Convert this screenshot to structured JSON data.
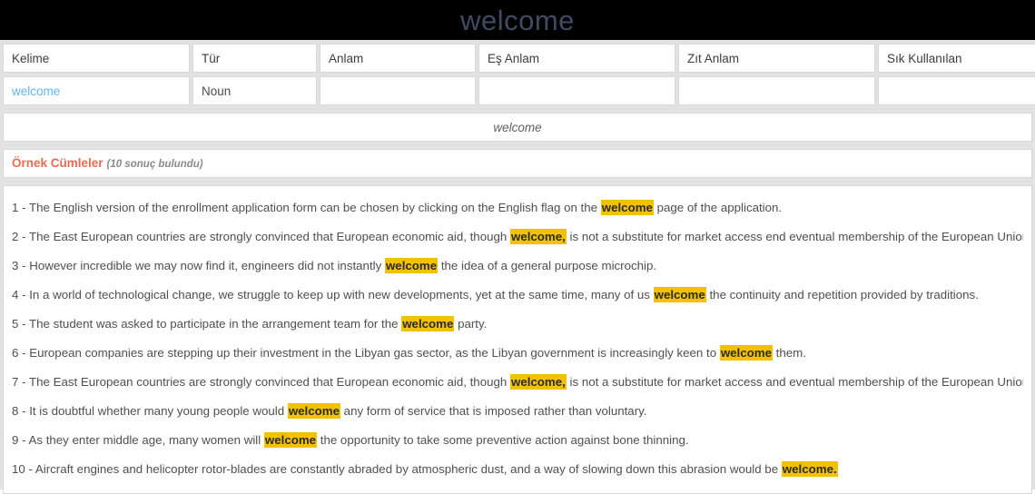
{
  "banner": {
    "title": "welcome"
  },
  "table": {
    "headers": [
      "Kelime",
      "Tür",
      "Anlam",
      "Eş Anlam",
      "Zıt Anlam",
      "Sık Kullanılan"
    ],
    "rows": [
      {
        "kelime": "welcome",
        "tur": "Noun",
        "anlam": "",
        "es_anlam": "",
        "zit_anlam": "",
        "sik_kullanilan": ""
      }
    ]
  },
  "strip": {
    "word": "welcome"
  },
  "examples": {
    "title": "Örnek Cümleler",
    "count_label": "(10 sonuç bulundu)",
    "highlight_color": "#f2c200",
    "items": [
      {
        "number": "1 - ",
        "before": "The English version of the enrollment application form can be chosen by clicking on the English flag on the ",
        "highlight": "welcome",
        "after": " page of the application."
      },
      {
        "number": "2 - ",
        "before": "The East European countries are strongly convinced that European economic aid, though ",
        "highlight": "welcome,",
        "after": " is not a substitute for market access end eventual membership of the European Union."
      },
      {
        "number": "3 - ",
        "before": "However incredible we may now find it, engineers did not instantly ",
        "highlight": "welcome",
        "after": " the idea of a general purpose microchip."
      },
      {
        "number": "4 - ",
        "before": "In a world of technological change, we struggle to keep up with new developments, yet at the same time, many of us ",
        "highlight": "welcome",
        "after": " the continuity and repetition provided by traditions."
      },
      {
        "number": "5 - ",
        "before": "The student was asked to participate in the arrangement team for the ",
        "highlight": "welcome",
        "after": " party."
      },
      {
        "number": "6 - ",
        "before": "European companies are stepping up their investment in the Libyan gas sector, as the Libyan government is increasingly keen to ",
        "highlight": "welcome",
        "after": " them."
      },
      {
        "number": "7 - ",
        "before": "The East European countries are strongly convinced that European economic aid, though ",
        "highlight": "welcome,",
        "after": " is not a substitute for market access and eventual membership of the European Union."
      },
      {
        "number": "8 - ",
        "before": "It is doubtful whether many young people would ",
        "highlight": "welcome",
        "after": " any form of service that is imposed rather than voluntary."
      },
      {
        "number": "9 - ",
        "before": "As they enter middle age, many women will ",
        "highlight": "welcome",
        "after": " the opportunity to take some preventive action against bone thinning."
      },
      {
        "number": "10 - ",
        "before": "Aircraft engines and helicopter rotor-blades are constantly abraded by atmospheric dust, and a way of slowing down this abrasion would be ",
        "highlight": "welcome.",
        "after": ""
      }
    ]
  }
}
